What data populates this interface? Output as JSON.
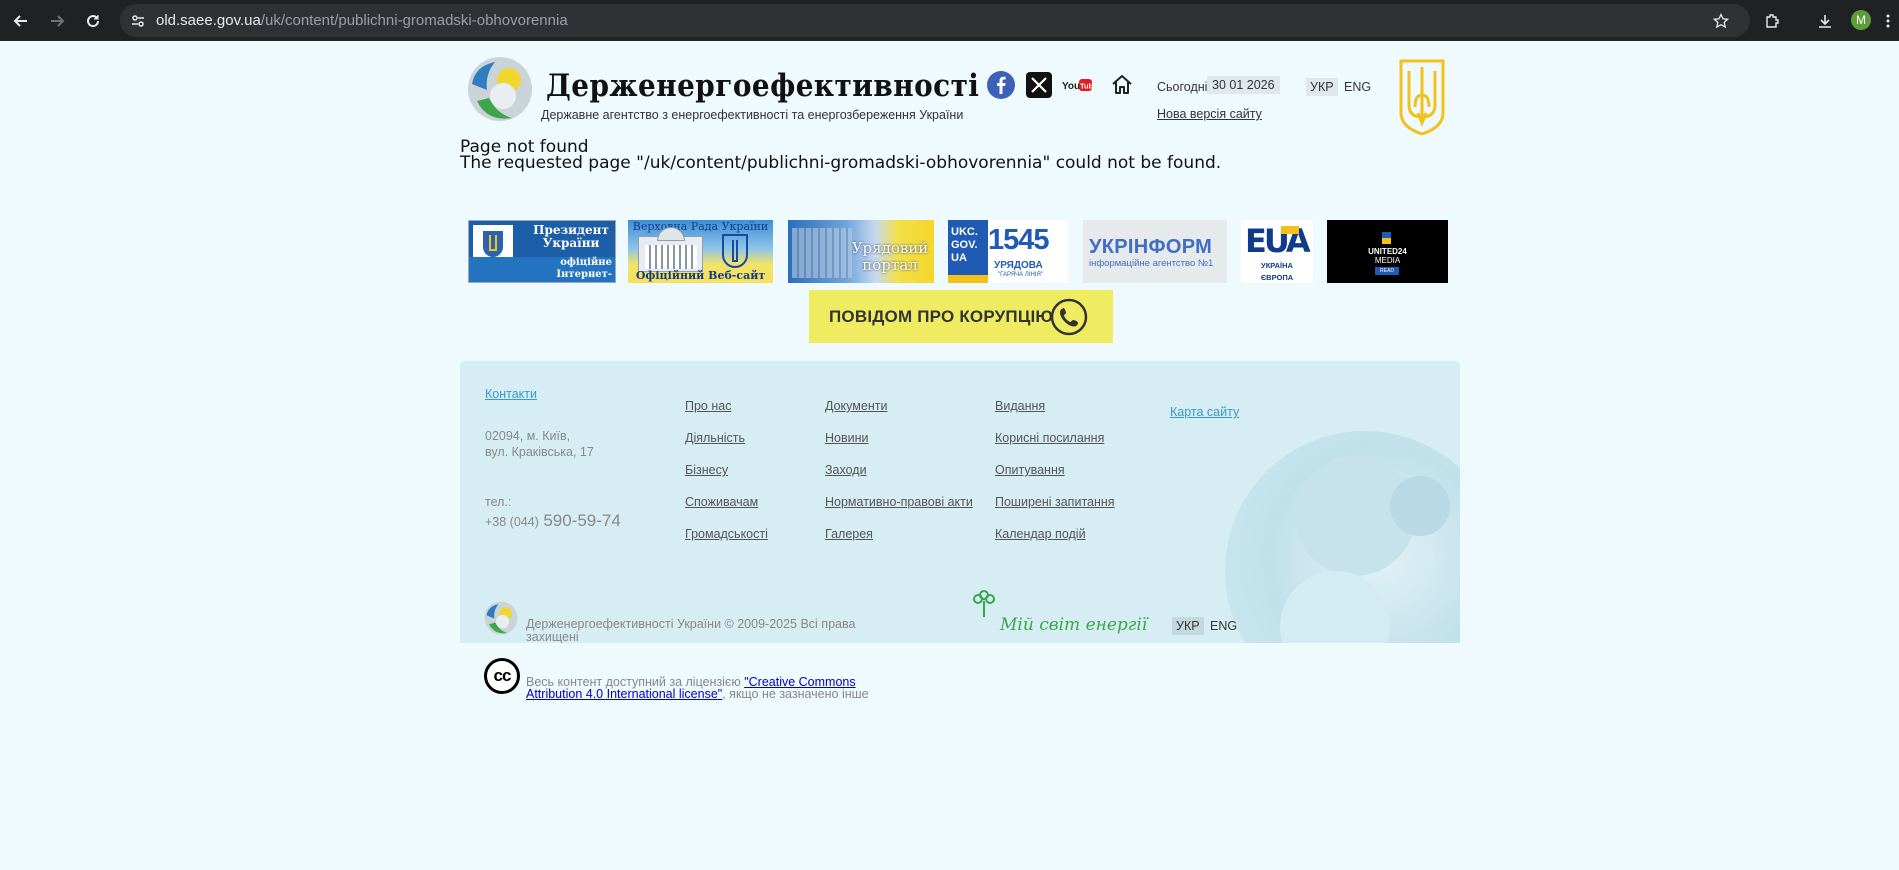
{
  "browser": {
    "url_host": "old.saee.gov.ua",
    "url_path": "/uk/content/publichni-gromadski-obhovorennia",
    "profile_initial": "M"
  },
  "header": {
    "title": "Держенергоефективності",
    "subtitle": "Державне агентство з енергоефективності та енергозбереження України",
    "today_label": "Сьогодні",
    "date": "30 01 2026",
    "new_version_link": "Нова версія сайту",
    "lang_ukr": "УКР",
    "lang_eng": "ENG",
    "youtube_label": "YouTube"
  },
  "error": {
    "title": "Page not found",
    "message": "The requested page \"/uk/content/publichni-gromadski-obhovorennia\" could not be found."
  },
  "banners": {
    "president_line1": "Президент",
    "president_line2": "України",
    "president_line3": "офіційне",
    "president_line4": "Інтернет-представництво",
    "rada_top": "Верховна Рада України",
    "rada_bottom": "Офіційний Веб-сайт",
    "gov_line1": "Урядовий",
    "gov_line2": "портал",
    "ukc_line1": "UKC.",
    "ukc_line2": "GOV.",
    "ukc_line3": "UA",
    "ukc_number": "1545",
    "ukc_sub": "УРЯДОВА",
    "ukc_sub2": "\"ГАРЯЧА ЛІНІЯ\"",
    "ukrinform_title": "УКРІНФОРМ",
    "ukrinform_sub": "інформаційне агентство №1",
    "eu_line1": "УКРАЇНА",
    "eu_line2": "ЄВРОПА",
    "united24_line1": "UNITED24",
    "united24_line2": "MEDIA",
    "united24_line3": "READ",
    "corruption": "ПОВІДОМ ПРО КОРУПЦІЮ"
  },
  "footer": {
    "contacts": "Контакти",
    "address_line1": "02094, м. Київ,",
    "address_line2": "вул. Краківська, 17",
    "phone_label": "тел.:",
    "phone_prefix": "+38 (044)",
    "phone_number": "590-59-74",
    "col1": [
      "Про нас",
      "Діяльність",
      "Бізнесу",
      "Споживачам",
      "Громадськості"
    ],
    "col2": [
      "Документи",
      "Новини",
      "Заходи",
      "Нормативно-правові акти",
      "Галерея"
    ],
    "col3": [
      "Видання",
      "Корисні посилання",
      "Опитування",
      "Поширені запитання",
      "Календар подій"
    ],
    "sitemap": "Карта сайту",
    "copyright_line1": "Держенергоефективності України © 2009-2025 Всі права",
    "copyright_line2": "захищені",
    "my_world": "Мій світ енергії",
    "lang_ukr": "УКР",
    "lang_eng": "ENG"
  },
  "license": {
    "prefix": "Весь контент доступний за ліцензією ",
    "link_line1": "\"Creative Commons",
    "link_line2": "Attribution 4.0 International license\"",
    "suffix": ", якщо не зазначено інше",
    "cc_mark": "cc"
  },
  "colors": {
    "page_bg": "#eefafd",
    "footer_bg": "#d6edf3",
    "accent_link": "#3a9ac9",
    "corruption_bg": "#f0ec62"
  }
}
